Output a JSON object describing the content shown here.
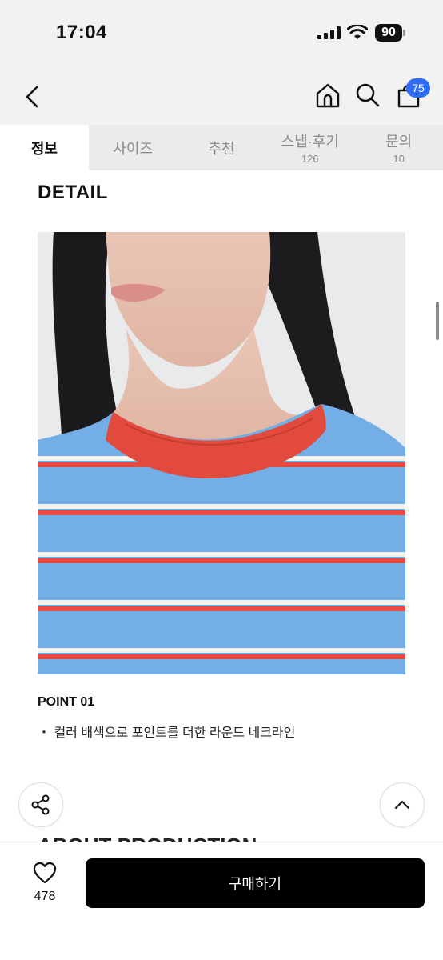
{
  "status_bar": {
    "time": "17:04",
    "battery": "90"
  },
  "nav": {
    "cart_count": "75"
  },
  "tabs": [
    {
      "label": "정보",
      "count": ""
    },
    {
      "label": "사이즈",
      "count": ""
    },
    {
      "label": "추천",
      "count": ""
    },
    {
      "label": "스냅·후기",
      "count": "126"
    },
    {
      "label": "문의",
      "count": "10"
    }
  ],
  "section": {
    "title": "DETAIL",
    "next_title": "ABOUT PRODUCTION"
  },
  "point": {
    "title": "POINT 01",
    "description": "・ 컬러 배색으로 포인트를 더한 라운드 네크라인"
  },
  "bottom_bar": {
    "like_count": "478",
    "buy_label": "구매하기"
  },
  "colors": {
    "badge": "#2f6cf5",
    "shirt_blue": "#74aee6",
    "stripe_red": "#e84a3c",
    "collar": "#e24a3d"
  }
}
